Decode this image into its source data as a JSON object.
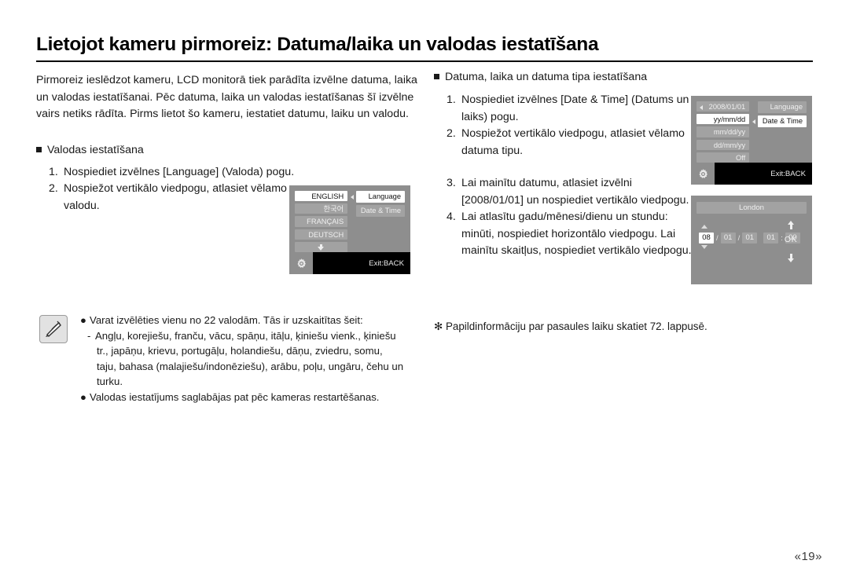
{
  "page": {
    "title": "Lietojot kameru pirmoreiz: Datuma/laika un valodas iestatīšana",
    "page_number": "«19»"
  },
  "left_column": {
    "intro_paragraph": "Pirmoreiz ieslēdzot kameru, LCD monitorā tiek parādīta izvēlne datuma, laika un valodas iestatīšanai. Pēc datuma, laika un valodas iestatīšanas šī izvēlne vairs netiks rādīta. Pirms lietot šo kameru, iestatiet datumu, laiku un valodu.",
    "section_heading": "Valodas iestatīšana",
    "steps": [
      {
        "num": "1.",
        "text": "Nospiediet izvēlnes [Language] (Valoda) pogu."
      },
      {
        "num": "2.",
        "text": "Nospiežot vertikālo viedpogu, atlasiet vēlamo valodu."
      }
    ]
  },
  "right_column": {
    "section_heading": "Datuma, laika un datuma tipa iestatīšana",
    "steps_top": [
      {
        "num": "1.",
        "text": "Nospiediet izvēlnes [Date & Time] (Datums un laiks) pogu."
      },
      {
        "num": "2.",
        "text": "Nospiežot vertikālo viedpogu, atlasiet vēlamo datuma tipu."
      }
    ],
    "steps_bottom": [
      {
        "num": "3.",
        "text": "Lai mainītu datumu, atlasiet izvēlni [2008/01/01] un nospiediet vertikālo viedpogu."
      },
      {
        "num": "4.",
        "text": "Lai atlasītu gadu/mēnesi/dienu un stundu: minūti, nospiediet horizontālo viedpogu. Lai mainītu skaitļus, nospiediet vertikālo viedpogu."
      }
    ]
  },
  "lcd_language": {
    "left_items": [
      {
        "label": "ENGLISH",
        "selected": true
      },
      {
        "label": "한국어",
        "selected": false
      },
      {
        "label": "FRANÇAIS",
        "selected": false
      },
      {
        "label": "DEUTSCH",
        "selected": false
      },
      {
        "label": "",
        "selected": false,
        "icon": "arrow-down-icon"
      }
    ],
    "right_items": [
      {
        "label": "Language",
        "selected": true
      },
      {
        "label": "Date & Time",
        "selected": false
      }
    ],
    "exit_label": "Exit:BACK",
    "gear_icon": "gear-icon",
    "pointer_icon": "triangle-left-icon"
  },
  "lcd_datetime": {
    "left_items": [
      {
        "label": "2008/01/01",
        "selected": false,
        "lead_icon": "triangle-left-icon"
      },
      {
        "label": "yy/mm/dd",
        "selected": true
      },
      {
        "label": "mm/dd/yy",
        "selected": false
      },
      {
        "label": "dd/mm/yy",
        "selected": false
      },
      {
        "label": "Off",
        "selected": false
      }
    ],
    "right_items": [
      {
        "label": "Language",
        "selected": false
      },
      {
        "label": "Date & Time",
        "selected": true
      }
    ],
    "exit_label": "Exit:BACK",
    "gear_icon": "gear-icon",
    "pointer_icon": "triangle-left-icon"
  },
  "lcd_worldtime": {
    "city": "London",
    "fields": [
      {
        "value": "08",
        "selected": true
      },
      {
        "value": "01",
        "selected": false
      },
      {
        "value": "01",
        "selected": false
      },
      {
        "value": "01",
        "selected": false
      },
      {
        "value": "00",
        "selected": false
      }
    ],
    "separators": {
      "date": "/",
      "time": ":"
    },
    "ok_label": "OK",
    "up_icon": "arrow-up-icon",
    "down_icon": "arrow-down-icon",
    "caret_up_icon": "caret-up-icon",
    "caret_down_icon": "caret-down-icon"
  },
  "note": {
    "icon": "memo-pencil-icon",
    "bullet1": "Varat izvēlēties vienu no 22 valodām. Tās ir uzskaitītas šeit:",
    "sub_line1": "Angļu, korejiešu, franču, vācu, spāņu, itāļu, ķiniešu vienk., ķiniešu",
    "sub_line2": "tr., japāņu, krievu, portugāļu, holandiešu, dāņu, zviedru, somu,",
    "sub_line3": "taju, bahasa (malajiešu/indonēziešu), arābu, poļu, ungāru, čehu un",
    "sub_line4": "turku.",
    "bullet2": "Valodas iestatījums saglabājas pat pēc kameras restartēšanas."
  },
  "star_note": {
    "text": "✻ Papildinformāciju par pasaules laiku skatiet 72. lappusē."
  },
  "colors": {
    "lcd_background": "#8e8e8e",
    "lcd_item": "#a2a2a2",
    "lcd_selected": "#ffffff",
    "lcd_bar": "#000000",
    "text": "#1a1a1a"
  }
}
